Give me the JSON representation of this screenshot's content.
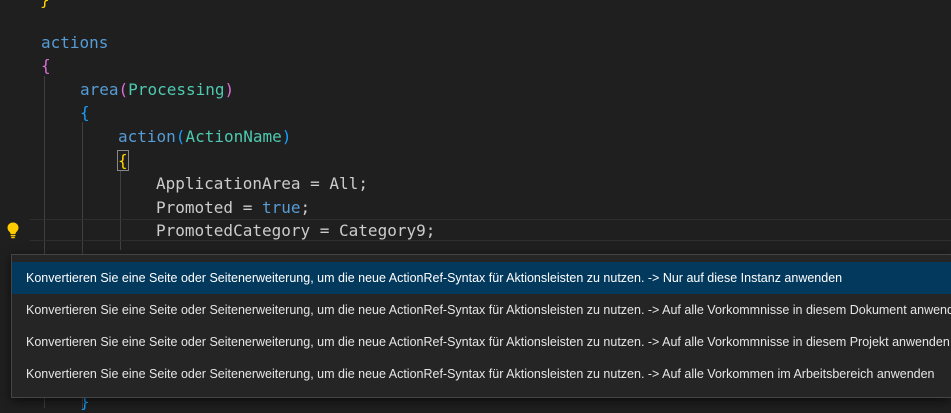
{
  "editor": {
    "lines": {
      "l0": {
        "text": "}"
      },
      "l1": {
        "kw": "actions"
      },
      "l2": {
        "br": "{"
      },
      "l3": {
        "fn": "area",
        "open": "(",
        "arg": "Processing",
        "close": ")"
      },
      "l4": {
        "br": "{"
      },
      "l5": {
        "fn": "action",
        "open": "(",
        "arg": "ActionName",
        "close": ")"
      },
      "l6": {
        "br": "{"
      },
      "l7": {
        "prop": "ApplicationArea",
        "op": " = ",
        "val": "All",
        "end": ";"
      },
      "l8": {
        "prop": "Promoted",
        "op": " = ",
        "val": "true",
        "end": ";"
      },
      "l9": {
        "prop": "PromotedCategory",
        "op": " = ",
        "val": "Category9",
        "end": ";"
      },
      "l10": {
        "br": "}"
      }
    },
    "lightbulb_icon": "lightbulb-icon",
    "lightbulb_color": "#ffcc00"
  },
  "quick_fix_menu": {
    "items": [
      {
        "label": "Konvertieren Sie eine Seite oder Seitenerweiterung, um die neue ActionRef-Syntax für Aktionsleisten zu nutzen. -> Nur auf diese Instanz anwenden",
        "selected": true
      },
      {
        "label": "Konvertieren Sie eine Seite oder Seitenerweiterung, um die neue ActionRef-Syntax für Aktionsleisten zu nutzen. -> Auf alle Vorkommnisse in diesem Dokument anwenden",
        "selected": false
      },
      {
        "label": "Konvertieren Sie eine Seite oder Seitenerweiterung, um die neue ActionRef-Syntax für Aktionsleisten zu nutzen. -> Auf alle Vorkommnisse in diesem Projekt anwenden",
        "selected": false
      },
      {
        "label": "Konvertieren Sie eine Seite oder Seitenerweiterung, um die neue ActionRef-Syntax für Aktionsleisten zu nutzen. -> Auf alle Vorkommen im Arbeitsbereich anwenden",
        "selected": false
      }
    ]
  },
  "colors": {
    "background": "#1f1f1f",
    "keyword": "#569cd6",
    "function": "#dcdcaa",
    "type": "#4ec9b0",
    "identifier": "#9cdcfe",
    "selection": "#04395e"
  }
}
